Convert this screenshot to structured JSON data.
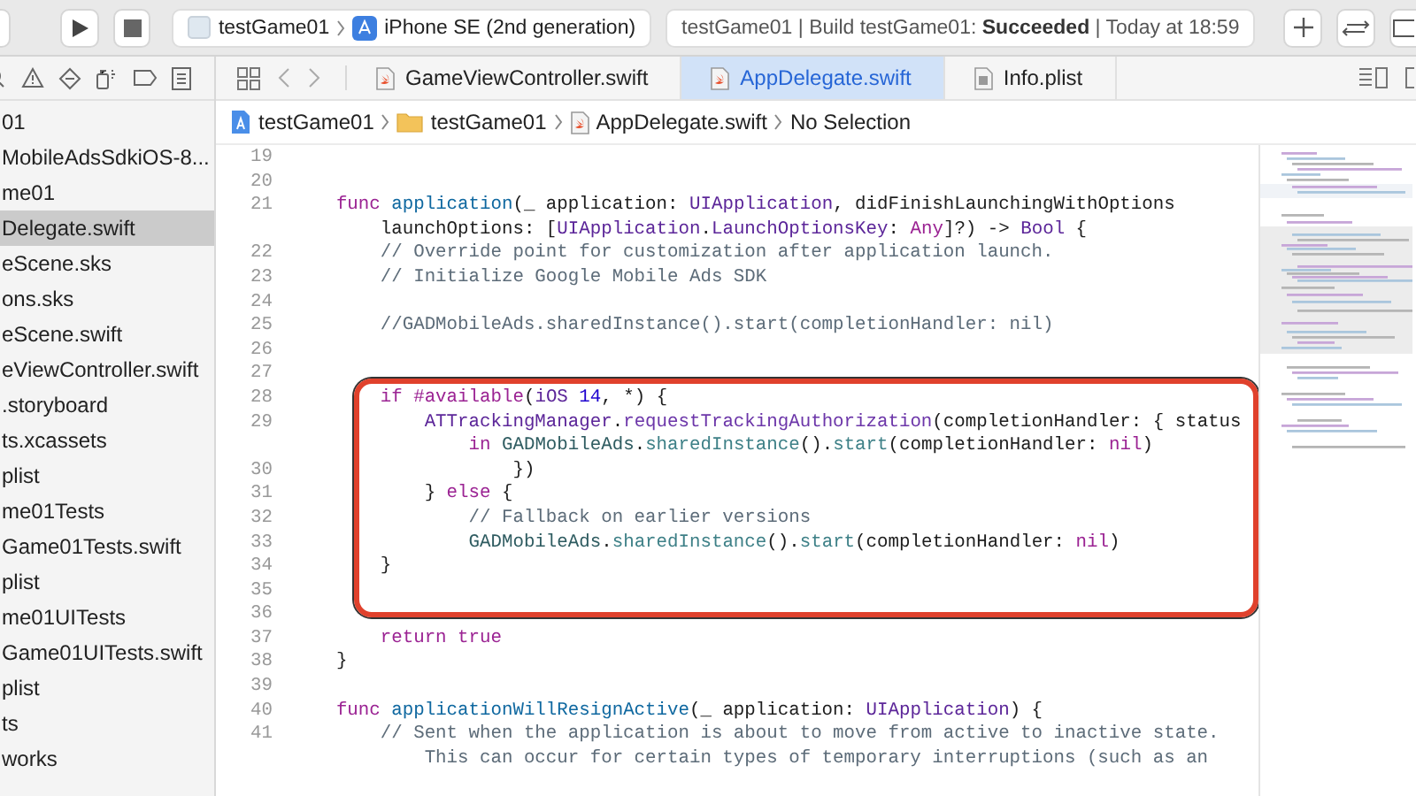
{
  "toolbar": {
    "scheme": {
      "target": "testGame01",
      "device": "iPhone SE (2nd generation)"
    },
    "status": "testGame01 | Build testGame01: **Succeeded** | Today at 18:59"
  },
  "navigator": {
    "items": [
      {
        "label": "01",
        "selected": false
      },
      {
        "label": "MobileAdsSdkiOS-8...",
        "selected": false
      },
      {
        "label": "me01",
        "selected": false
      },
      {
        "label": "Delegate.swift",
        "selected": true
      },
      {
        "label": "eScene.sks",
        "selected": false
      },
      {
        "label": "ons.sks",
        "selected": false
      },
      {
        "label": "eScene.swift",
        "selected": false
      },
      {
        "label": "eViewController.swift",
        "selected": false
      },
      {
        "label": ".storyboard",
        "selected": false
      },
      {
        "label": "ts.xcassets",
        "selected": false
      },
      {
        "label": "plist",
        "selected": false
      },
      {
        "label": "me01Tests",
        "selected": false
      },
      {
        "label": "Game01Tests.swift",
        "selected": false
      },
      {
        "label": "plist",
        "selected": false
      },
      {
        "label": "me01UITests",
        "selected": false
      },
      {
        "label": "Game01UITests.swift",
        "selected": false
      },
      {
        "label": "plist",
        "selected": false
      },
      {
        "label": "ts",
        "selected": false
      },
      {
        "label": "works",
        "selected": false
      }
    ]
  },
  "tabs": [
    {
      "label": "GameViewController.swift",
      "kind": "swift",
      "selected": false
    },
    {
      "label": "AppDelegate.swift",
      "kind": "swift",
      "selected": true
    },
    {
      "label": "Info.plist",
      "kind": "plist",
      "selected": false
    }
  ],
  "breadcrumb": [
    {
      "label": "testGame01",
      "kind": "project"
    },
    {
      "label": "testGame01",
      "kind": "folder"
    },
    {
      "label": "AppDelegate.swift",
      "kind": "swift"
    },
    {
      "label": "No Selection",
      "kind": "none"
    }
  ],
  "code": [
    {
      "highlighted": false,
      "lines": [
        {
          "number": "19"
        },
        {
          "number": "20"
        },
        {
          "number": "21",
          "tokens": [
            {
              "kind": "keyword",
              "text": "    func"
            },
            {
              "kind": "decl",
              "text": " application"
            },
            {
              "kind": "plain",
              "text": "(_ application: "
            },
            {
              "kind": "type",
              "text": "UIApplication"
            },
            {
              "kind": "plain",
              "text": ", didFinishLaunchingWithOptions"
            }
          ]
        },
        {
          "tokens": [
            {
              "kind": "plain",
              "text": "        launchOptions: ["
            },
            {
              "kind": "type",
              "text": "UIApplication"
            },
            {
              "kind": "plain",
              "text": "."
            },
            {
              "kind": "type",
              "text": "LaunchOptionsKey"
            },
            {
              "kind": "plain",
              "text": ": "
            },
            {
              "kind": "keyword",
              "text": "Any"
            },
            {
              "kind": "plain",
              "text": "]?) -> "
            },
            {
              "kind": "type",
              "text": "Bool"
            },
            {
              "kind": "plain",
              "text": " {"
            }
          ]
        },
        {
          "number": "22",
          "tokens": [
            {
              "kind": "comment",
              "text": "        // Override point for customization after application launch."
            }
          ]
        },
        {
          "number": "23",
          "tokens": [
            {
              "kind": "comment",
              "text": "        // Initialize Google Mobile Ads SDK"
            }
          ]
        },
        {
          "number": "24"
        },
        {
          "number": "25",
          "tokens": [
            {
              "kind": "comment",
              "text": "        //GADMobileAds.sharedInstance().start(completionHandler: nil)"
            }
          ]
        },
        {
          "number": "26"
        },
        {
          "number": "27"
        }
      ]
    },
    {
      "highlighted": true,
      "lines": [
        {
          "number": "28",
          "tokens": [
            {
              "kind": "keyword",
              "text": "        if #available"
            },
            {
              "kind": "plain",
              "text": "("
            },
            {
              "kind": "type",
              "text": "iOS"
            },
            {
              "kind": "number",
              "text": " 14"
            },
            {
              "kind": "plain",
              "text": ", *) {"
            }
          ]
        },
        {
          "number": "29",
          "tokens": [
            {
              "kind": "type",
              "text": "            ATTrackingManager"
            },
            {
              "kind": "plain",
              "text": "."
            },
            {
              "kind": "method",
              "text": "requestTrackingAuthorization"
            },
            {
              "kind": "plain",
              "text": "(completionHandler: { status"
            }
          ]
        },
        {
          "tokens": [
            {
              "kind": "keyword",
              "text": "                in"
            },
            {
              "kind": "project",
              "text": " GADMobileAds"
            },
            {
              "kind": "plain",
              "text": "."
            },
            {
              "kind": "call",
              "text": "sharedInstance"
            },
            {
              "kind": "plain",
              "text": "()."
            },
            {
              "kind": "call",
              "text": "start"
            },
            {
              "kind": "plain",
              "text": "(completionHandler: "
            },
            {
              "kind": "keyword",
              "text": "nil"
            },
            {
              "kind": "plain",
              "text": ")"
            }
          ]
        },
        {
          "number": "30",
          "tokens": [
            {
              "kind": "plain",
              "text": "                    })"
            }
          ]
        },
        {
          "number": "31",
          "tokens": [
            {
              "kind": "plain",
              "text": "            }"
            },
            {
              "kind": "keyword",
              "text": " else"
            },
            {
              "kind": "plain",
              "text": " {"
            }
          ]
        },
        {
          "number": "32",
          "tokens": [
            {
              "kind": "comment",
              "text": "                // Fallback on earlier versions"
            }
          ]
        },
        {
          "number": "33",
          "tokens": [
            {
              "kind": "project",
              "text": "                GADMobileAds"
            },
            {
              "kind": "plain",
              "text": "."
            },
            {
              "kind": "call",
              "text": "sharedInstance"
            },
            {
              "kind": "plain",
              "text": "()."
            },
            {
              "kind": "call",
              "text": "start"
            },
            {
              "kind": "plain",
              "text": "(completionHandler: "
            },
            {
              "kind": "keyword",
              "text": "nil"
            },
            {
              "kind": "plain",
              "text": ")"
            }
          ]
        },
        {
          "number": "34",
          "tokens": [
            {
              "kind": "plain",
              "text": "        }"
            }
          ]
        },
        {
          "number": "35"
        }
      ]
    },
    {
      "highlighted": false,
      "lines": [
        {
          "number": "36"
        },
        {
          "number": "37",
          "tokens": [
            {
              "kind": "keyword",
              "text": "        return true"
            }
          ]
        },
        {
          "number": "38",
          "tokens": [
            {
              "kind": "plain",
              "text": "    }"
            }
          ]
        },
        {
          "number": "39"
        },
        {
          "number": "40",
          "tokens": [
            {
              "kind": "keyword",
              "text": "    func"
            },
            {
              "kind": "decl",
              "text": " applicationWillResignActive"
            },
            {
              "kind": "plain",
              "text": "(_ application: "
            },
            {
              "kind": "type",
              "text": "UIApplication"
            },
            {
              "kind": "plain",
              "text": ") {"
            }
          ]
        },
        {
          "number": "41",
          "tokens": [
            {
              "kind": "comment",
              "text": "        // Sent when the application is about to move from active to inactive state."
            }
          ]
        },
        {
          "tokens": [
            {
              "kind": "comment",
              "text": "            This can occur for certain types of temporary interruptions (such as an"
            }
          ]
        }
      ]
    }
  ]
}
